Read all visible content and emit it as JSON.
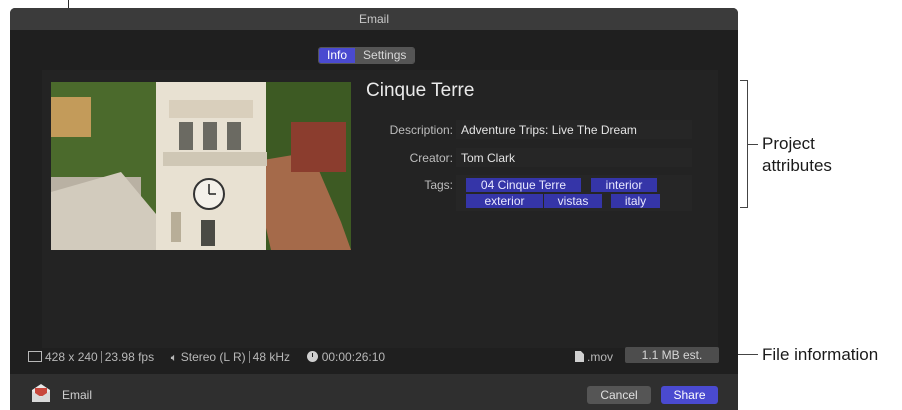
{
  "window": {
    "title": "Email"
  },
  "tabs": [
    {
      "label": "Info",
      "active": true
    },
    {
      "label": "Settings",
      "active": false
    }
  ],
  "project": {
    "title": "Cinque Terre",
    "fields": {
      "description_label": "Description:",
      "description_value": "Adventure Trips: Live The Dream",
      "creator_label": "Creator:",
      "creator_value": "Tom Clark",
      "tags_label": "Tags:"
    },
    "tags": [
      "04 Cinque Terre",
      "interior",
      "exterior",
      "vistas",
      "italy"
    ]
  },
  "file_info": {
    "resolution": "428 x 240",
    "frame_rate": "23.98 fps",
    "audio": "Stereo (L R)",
    "sample_rate": "48 kHz",
    "duration": "00:00:26:10",
    "extension": ".mov",
    "size_estimate": "1.1 MB est."
  },
  "bottom": {
    "destination": "Email",
    "cancel_label": "Cancel",
    "share_label": "Share"
  },
  "annotations": {
    "project_attributes_line1": "Project",
    "project_attributes_line2": "attributes",
    "file_information": "File information"
  },
  "colors": {
    "accent": "#4a4ad0",
    "tag_bg": "#3535a8",
    "dialog_bg": "#1f1f1f"
  }
}
